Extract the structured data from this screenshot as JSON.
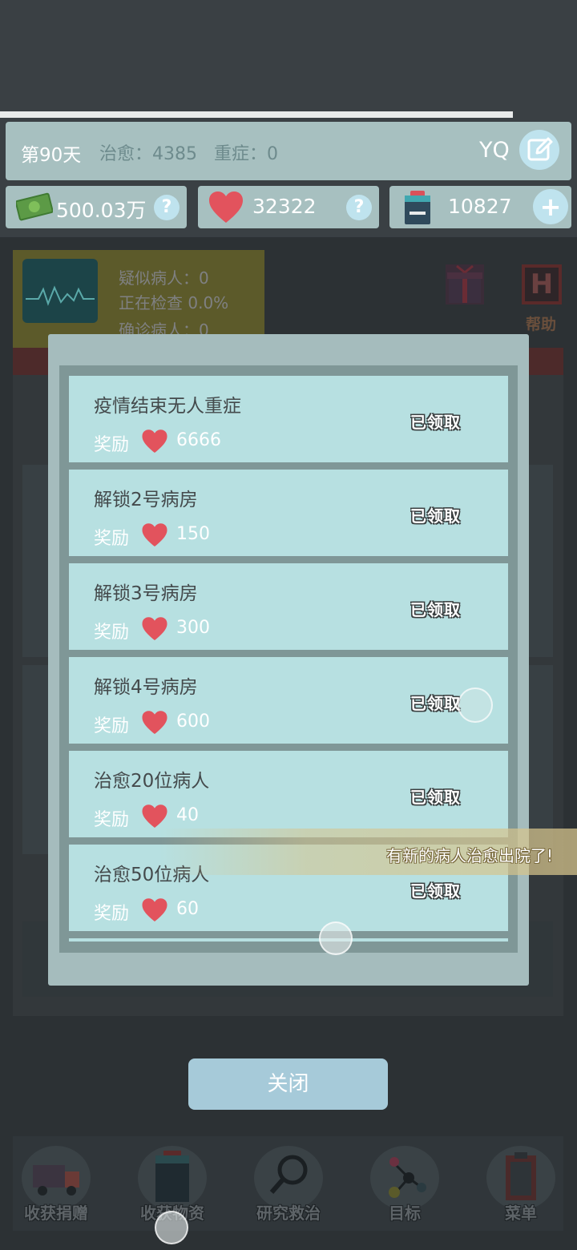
{
  "status": {
    "day": "第90天",
    "cured": "治愈：4385",
    "severe": "重症：0",
    "user": "YQ"
  },
  "resources": {
    "money": "500.03万",
    "hearts": "32322",
    "supplies": "10827",
    "help_q": "?",
    "add": "+"
  },
  "game": {
    "suspected": "疑似病人：0",
    "checking": "正在检查 0.0%",
    "confirmed": "确诊病人：0",
    "help_label": "帮助",
    "help_letter": "H"
  },
  "goals": {
    "reward_label": "奖励",
    "claimed_label": "已领取",
    "items": [
      {
        "title": "疫情结束无人重症",
        "reward": "6666"
      },
      {
        "title": "解锁2号病房",
        "reward": "150"
      },
      {
        "title": "解锁3号病房",
        "reward": "300"
      },
      {
        "title": "解锁4号病房",
        "reward": "600"
      },
      {
        "title": "治愈20位病人",
        "reward": "40"
      },
      {
        "title": "治愈50位病人",
        "reward": "60"
      }
    ]
  },
  "toast": "有新的病人治愈出院了!",
  "close_label": "关闭",
  "nav": {
    "donations": "收获捐赠",
    "supplies": "收获物资",
    "research": "研究救治",
    "goals": "目标",
    "menu": "菜单"
  },
  "colors": {
    "heart": "#e2535d",
    "panel": "#a7c0c0",
    "item_bg": "#b7e0e1",
    "close_button": "#a6cad9"
  }
}
